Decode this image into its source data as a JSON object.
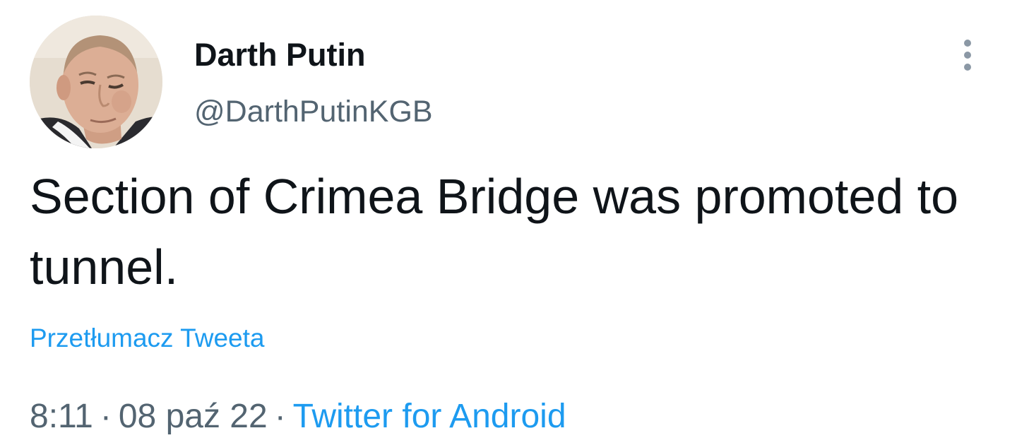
{
  "author": {
    "display_name": "Darth Putin",
    "handle": "@DarthPutinKGB",
    "avatar_icon": "profile-photo"
  },
  "tweet": {
    "text": "Section of Crimea Bridge was promoted to tunnel.",
    "translate_label": "Przetłumacz Tweeta"
  },
  "meta": {
    "time": "8:11",
    "separator": "·",
    "date": "08 paź 22",
    "source": "Twitter for Android"
  },
  "menu": {
    "icon": "more-vertical-icon"
  },
  "colors": {
    "text_primary": "#0f1419",
    "text_secondary": "#536471",
    "link": "#1d9bf0",
    "icon_muted": "#8b98a5",
    "background": "#ffffff"
  }
}
